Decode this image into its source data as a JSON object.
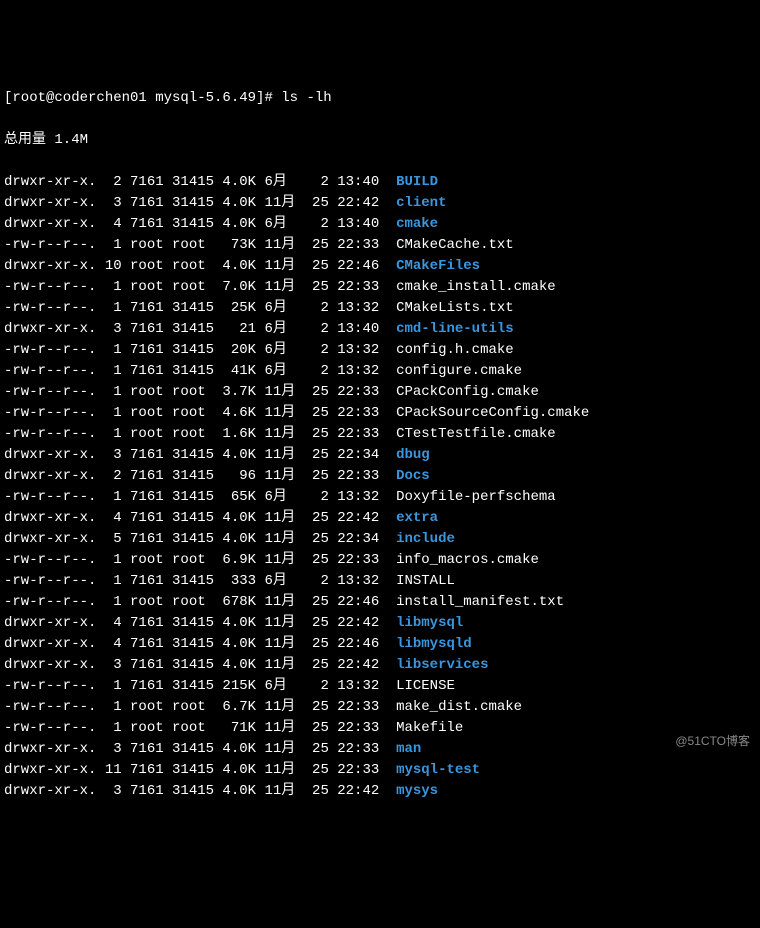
{
  "prompt": "[root@coderchen01 mysql-5.6.49]# ls -lh",
  "total": "总用量 1.4M",
  "watermark": "@51CTO博客",
  "entries": [
    {
      "perms": "drwxr-xr-x.",
      "links": "2",
      "owner": "7161",
      "group": "31415",
      "size": "4.0K",
      "month": "6月",
      "day": "2",
      "time": "13:40",
      "name": "BUILD",
      "isdir": true
    },
    {
      "perms": "drwxr-xr-x.",
      "links": "3",
      "owner": "7161",
      "group": "31415",
      "size": "4.0K",
      "month": "11月",
      "day": "25",
      "time": "22:42",
      "name": "client",
      "isdir": true
    },
    {
      "perms": "drwxr-xr-x.",
      "links": "4",
      "owner": "7161",
      "group": "31415",
      "size": "4.0K",
      "month": "6月",
      "day": "2",
      "time": "13:40",
      "name": "cmake",
      "isdir": true
    },
    {
      "perms": "-rw-r--r--.",
      "links": "1",
      "owner": "root",
      "group": "root",
      "size": "73K",
      "month": "11月",
      "day": "25",
      "time": "22:33",
      "name": "CMakeCache.txt",
      "isdir": false
    },
    {
      "perms": "drwxr-xr-x.",
      "links": "10",
      "owner": "root",
      "group": "root",
      "size": "4.0K",
      "month": "11月",
      "day": "25",
      "time": "22:46",
      "name": "CMakeFiles",
      "isdir": true
    },
    {
      "perms": "-rw-r--r--.",
      "links": "1",
      "owner": "root",
      "group": "root",
      "size": "7.0K",
      "month": "11月",
      "day": "25",
      "time": "22:33",
      "name": "cmake_install.cmake",
      "isdir": false
    },
    {
      "perms": "-rw-r--r--.",
      "links": "1",
      "owner": "7161",
      "group": "31415",
      "size": "25K",
      "month": "6月",
      "day": "2",
      "time": "13:32",
      "name": "CMakeLists.txt",
      "isdir": false
    },
    {
      "perms": "drwxr-xr-x.",
      "links": "3",
      "owner": "7161",
      "group": "31415",
      "size": "21",
      "month": "6月",
      "day": "2",
      "time": "13:40",
      "name": "cmd-line-utils",
      "isdir": true
    },
    {
      "perms": "-rw-r--r--.",
      "links": "1",
      "owner": "7161",
      "group": "31415",
      "size": "20K",
      "month": "6月",
      "day": "2",
      "time": "13:32",
      "name": "config.h.cmake",
      "isdir": false
    },
    {
      "perms": "-rw-r--r--.",
      "links": "1",
      "owner": "7161",
      "group": "31415",
      "size": "41K",
      "month": "6月",
      "day": "2",
      "time": "13:32",
      "name": "configure.cmake",
      "isdir": false
    },
    {
      "perms": "-rw-r--r--.",
      "links": "1",
      "owner": "root",
      "group": "root",
      "size": "3.7K",
      "month": "11月",
      "day": "25",
      "time": "22:33",
      "name": "CPackConfig.cmake",
      "isdir": false
    },
    {
      "perms": "-rw-r--r--.",
      "links": "1",
      "owner": "root",
      "group": "root",
      "size": "4.6K",
      "month": "11月",
      "day": "25",
      "time": "22:33",
      "name": "CPackSourceConfig.cmake",
      "isdir": false
    },
    {
      "perms": "-rw-r--r--.",
      "links": "1",
      "owner": "root",
      "group": "root",
      "size": "1.6K",
      "month": "11月",
      "day": "25",
      "time": "22:33",
      "name": "CTestTestfile.cmake",
      "isdir": false
    },
    {
      "perms": "drwxr-xr-x.",
      "links": "3",
      "owner": "7161",
      "group": "31415",
      "size": "4.0K",
      "month": "11月",
      "day": "25",
      "time": "22:34",
      "name": "dbug",
      "isdir": true
    },
    {
      "perms": "drwxr-xr-x.",
      "links": "2",
      "owner": "7161",
      "group": "31415",
      "size": "96",
      "month": "11月",
      "day": "25",
      "time": "22:33",
      "name": "Docs",
      "isdir": true
    },
    {
      "perms": "-rw-r--r--.",
      "links": "1",
      "owner": "7161",
      "group": "31415",
      "size": "65K",
      "month": "6月",
      "day": "2",
      "time": "13:32",
      "name": "Doxyfile-perfschema",
      "isdir": false
    },
    {
      "perms": "drwxr-xr-x.",
      "links": "4",
      "owner": "7161",
      "group": "31415",
      "size": "4.0K",
      "month": "11月",
      "day": "25",
      "time": "22:42",
      "name": "extra",
      "isdir": true
    },
    {
      "perms": "drwxr-xr-x.",
      "links": "5",
      "owner": "7161",
      "group": "31415",
      "size": "4.0K",
      "month": "11月",
      "day": "25",
      "time": "22:34",
      "name": "include",
      "isdir": true
    },
    {
      "perms": "-rw-r--r--.",
      "links": "1",
      "owner": "root",
      "group": "root",
      "size": "6.9K",
      "month": "11月",
      "day": "25",
      "time": "22:33",
      "name": "info_macros.cmake",
      "isdir": false
    },
    {
      "perms": "-rw-r--r--.",
      "links": "1",
      "owner": "7161",
      "group": "31415",
      "size": "333",
      "month": "6月",
      "day": "2",
      "time": "13:32",
      "name": "INSTALL",
      "isdir": false
    },
    {
      "perms": "-rw-r--r--.",
      "links": "1",
      "owner": "root",
      "group": "root",
      "size": "678K",
      "month": "11月",
      "day": "25",
      "time": "22:46",
      "name": "install_manifest.txt",
      "isdir": false
    },
    {
      "perms": "drwxr-xr-x.",
      "links": "4",
      "owner": "7161",
      "group": "31415",
      "size": "4.0K",
      "month": "11月",
      "day": "25",
      "time": "22:42",
      "name": "libmysql",
      "isdir": true
    },
    {
      "perms": "drwxr-xr-x.",
      "links": "4",
      "owner": "7161",
      "group": "31415",
      "size": "4.0K",
      "month": "11月",
      "day": "25",
      "time": "22:46",
      "name": "libmysqld",
      "isdir": true
    },
    {
      "perms": "drwxr-xr-x.",
      "links": "3",
      "owner": "7161",
      "group": "31415",
      "size": "4.0K",
      "month": "11月",
      "day": "25",
      "time": "22:42",
      "name": "libservices",
      "isdir": true
    },
    {
      "perms": "-rw-r--r--.",
      "links": "1",
      "owner": "7161",
      "group": "31415",
      "size": "215K",
      "month": "6月",
      "day": "2",
      "time": "13:32",
      "name": "LICENSE",
      "isdir": false
    },
    {
      "perms": "-rw-r--r--.",
      "links": "1",
      "owner": "root",
      "group": "root",
      "size": "6.7K",
      "month": "11月",
      "day": "25",
      "time": "22:33",
      "name": "make_dist.cmake",
      "isdir": false
    },
    {
      "perms": "-rw-r--r--.",
      "links": "1",
      "owner": "root",
      "group": "root",
      "size": "71K",
      "month": "11月",
      "day": "25",
      "time": "22:33",
      "name": "Makefile",
      "isdir": false
    },
    {
      "perms": "drwxr-xr-x.",
      "links": "3",
      "owner": "7161",
      "group": "31415",
      "size": "4.0K",
      "month": "11月",
      "day": "25",
      "time": "22:33",
      "name": "man",
      "isdir": true
    },
    {
      "perms": "drwxr-xr-x.",
      "links": "11",
      "owner": "7161",
      "group": "31415",
      "size": "4.0K",
      "month": "11月",
      "day": "25",
      "time": "22:33",
      "name": "mysql-test",
      "isdir": true
    },
    {
      "perms": "drwxr-xr-x.",
      "links": "3",
      "owner": "7161",
      "group": "31415",
      "size": "4.0K",
      "month": "11月",
      "day": "25",
      "time": "22:42",
      "name": "mysys",
      "isdir": true
    }
  ]
}
